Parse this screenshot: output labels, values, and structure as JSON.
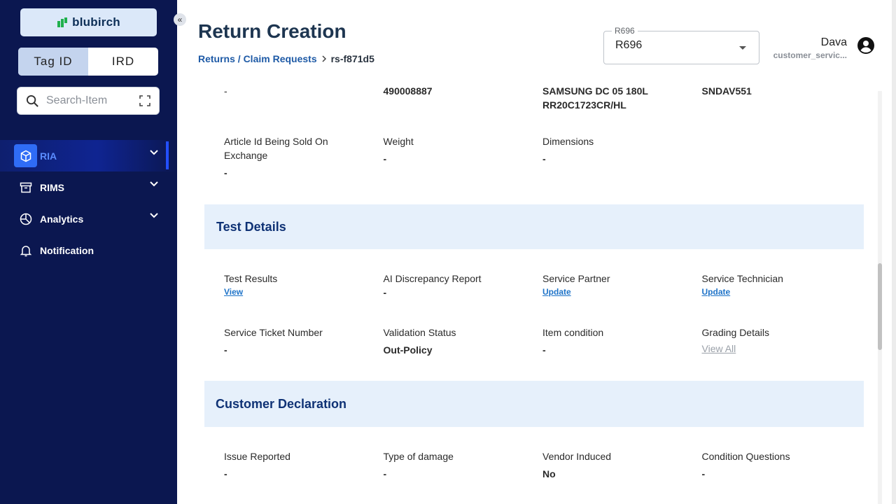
{
  "app": {
    "logo_text": "blubirch"
  },
  "sidebar": {
    "toggle": {
      "left": "Tag ID",
      "right": "IRD"
    },
    "search_placeholder": "Search-Item",
    "items": [
      {
        "label": "RIA",
        "icon": "box-icon",
        "active": true
      },
      {
        "label": "RIMS",
        "icon": "archive-icon"
      },
      {
        "label": "Analytics",
        "icon": "pie-chart-icon"
      },
      {
        "label": "Notification",
        "icon": "bell-icon"
      }
    ]
  },
  "header": {
    "title": "Return Creation",
    "breadcrumb": {
      "link": "Returns / Claim Requests",
      "current": "rs-f871d5"
    },
    "select": {
      "legend": "R696",
      "value": "R696"
    },
    "user": {
      "name": "Dava",
      "role": "customer_servic..."
    }
  },
  "content": {
    "top_row": [
      "-",
      "490008887",
      "SAMSUNG DC 05 180L",
      "SNDAV551"
    ],
    "top_row_line2": "RR20C1723CR/HL",
    "row1": [
      {
        "label": "Article Id Being Sold On Exchange",
        "value": "-"
      },
      {
        "label": "Weight",
        "value": "-"
      },
      {
        "label": "Dimensions",
        "value": "-"
      }
    ],
    "test_details": {
      "title": "Test Details",
      "row1": [
        {
          "label": "Test Results",
          "value": "View"
        },
        {
          "label": "AI Discrepancy Report",
          "value": "-"
        },
        {
          "label": "Service Partner",
          "value": "Update"
        },
        {
          "label": "Service Technician",
          "value": "Update"
        }
      ],
      "row2": [
        {
          "label": "Service Ticket Number",
          "value": "-"
        },
        {
          "label": "Validation Status",
          "value": "Out-Policy"
        },
        {
          "label": "Item condition",
          "value": "-"
        },
        {
          "label": "Grading Details",
          "value": "View All"
        }
      ]
    },
    "customer_declaration": {
      "title": "Customer Declaration",
      "row1": [
        {
          "label": "Issue Reported",
          "value": "-"
        },
        {
          "label": "Type of damage",
          "value": "-"
        },
        {
          "label": "Vendor Induced",
          "value": "No"
        },
        {
          "label": "Condition Questions",
          "value": "-"
        }
      ]
    }
  },
  "colors": {
    "sidebar_bg": "#0b1750",
    "section_bg": "#e6f0fb",
    "accent": "#2f6cf6",
    "link": "#1e73c8"
  }
}
